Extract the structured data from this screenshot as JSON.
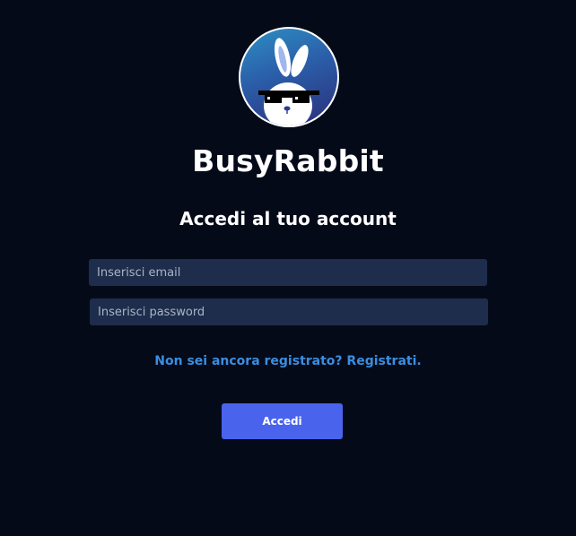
{
  "app": {
    "name": "BusyRabbit",
    "logo_icon": "rabbit-sunglasses-logo"
  },
  "login": {
    "heading": "Accedi al tuo account",
    "email_placeholder": "Inserisci email",
    "email_value": "",
    "password_placeholder": "Inserisci password",
    "password_value": "",
    "register_link": "Non sei ancora registrato? Registrati.",
    "submit_label": "Accedi"
  },
  "colors": {
    "background": "#050a19",
    "input_background": "#1e2d4b",
    "link": "#3a8ee0",
    "button": "#4a63ec",
    "text": "#ffffff"
  }
}
